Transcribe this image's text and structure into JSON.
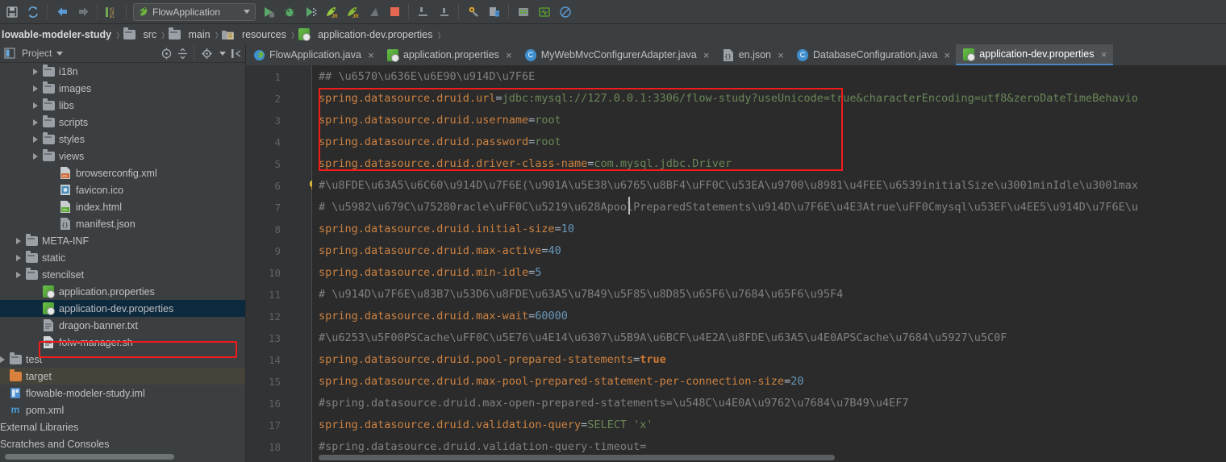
{
  "toolbar": {
    "buttons": [
      {
        "name": "save-all-icon",
        "glyph": "💾"
      },
      {
        "name": "sync-icon",
        "glyph": "⟳"
      },
      {
        "name": "back-icon",
        "glyph": "←"
      },
      {
        "name": "forward-icon",
        "glyph": "→"
      },
      {
        "name": "toggle-bookmarks-icon",
        "glyph": "01"
      },
      {
        "name": "run-icon",
        "glyph": "▶"
      },
      {
        "name": "debug-icon",
        "glyph": "🐞"
      },
      {
        "name": "run-coverage-icon",
        "glyph": "▶"
      },
      {
        "name": "run-jrebel-icon",
        "glyph": "JR"
      },
      {
        "name": "debug-jrebel-icon",
        "glyph": "JR"
      },
      {
        "name": "profile-icon",
        "glyph": "▲"
      },
      {
        "name": "stop-icon",
        "glyph": "■"
      },
      {
        "name": "build-project-icon",
        "glyph": "🔨"
      },
      {
        "name": "build-module-icon",
        "glyph": "🔨"
      },
      {
        "name": "settings-icon",
        "glyph": "🔧"
      },
      {
        "name": "project-structure-icon",
        "glyph": "☷"
      },
      {
        "name": "sdk-manager-icon",
        "glyph": "▦"
      },
      {
        "name": "avd-manager-icon",
        "glyph": "□"
      },
      {
        "name": "no-entry-icon",
        "glyph": "⊘"
      }
    ],
    "run_configuration": "FlowApplication"
  },
  "breadcrumb": {
    "items": [
      {
        "label": "lowable-modeler-study",
        "icon": ""
      },
      {
        "label": "src",
        "icon": "folder-icon"
      },
      {
        "label": "main",
        "icon": "folder-icon"
      },
      {
        "label": "resources",
        "icon": "resources-folder-icon"
      },
      {
        "label": "application-dev.properties",
        "icon": "properties-file-icon"
      }
    ]
  },
  "project_panel": {
    "title": "Project",
    "header_icons": [
      "locate-icon",
      "collapse-all-icon",
      "settings-icon",
      "hide-icon"
    ],
    "tree": [
      {
        "label": "i18n",
        "indent": 3,
        "arrow": true,
        "icon": "folder-icon",
        "state": "normal"
      },
      {
        "label": "images",
        "indent": 3,
        "arrow": true,
        "icon": "folder-icon",
        "state": "normal"
      },
      {
        "label": "libs",
        "indent": 3,
        "arrow": true,
        "icon": "folder-icon",
        "state": "normal"
      },
      {
        "label": "scripts",
        "indent": 3,
        "arrow": true,
        "icon": "folder-icon",
        "state": "normal"
      },
      {
        "label": "styles",
        "indent": 3,
        "arrow": true,
        "icon": "folder-icon",
        "state": "normal"
      },
      {
        "label": "views",
        "indent": 3,
        "arrow": true,
        "icon": "folder-icon",
        "state": "normal"
      },
      {
        "label": "browserconfig.xml",
        "indent": 4,
        "arrow": false,
        "icon": "xml-file-icon",
        "state": "normal"
      },
      {
        "label": "favicon.ico",
        "indent": 4,
        "arrow": false,
        "icon": "ico-file-icon",
        "state": "normal"
      },
      {
        "label": "index.html",
        "indent": 4,
        "arrow": false,
        "icon": "html-file-icon",
        "state": "normal"
      },
      {
        "label": "manifest.json",
        "indent": 4,
        "arrow": false,
        "icon": "json-file-icon",
        "state": "normal"
      },
      {
        "label": "META-INF",
        "indent": 2,
        "arrow": true,
        "icon": "folder-icon",
        "state": "normal"
      },
      {
        "label": "static",
        "indent": 2,
        "arrow": true,
        "icon": "folder-icon",
        "state": "normal"
      },
      {
        "label": "stencilset",
        "indent": 2,
        "arrow": true,
        "icon": "folder-icon",
        "state": "normal"
      },
      {
        "label": "application.properties",
        "indent": 3,
        "arrow": false,
        "icon": "properties-file-icon",
        "state": "normal"
      },
      {
        "label": "application-dev.properties",
        "indent": 3,
        "arrow": false,
        "icon": "properties-file-icon",
        "state": "selected"
      },
      {
        "label": "dragon-banner.txt",
        "indent": 3,
        "arrow": false,
        "icon": "txt-file-icon",
        "state": "normal"
      },
      {
        "label": "folw-manager.sh",
        "indent": 3,
        "arrow": false,
        "icon": "sh-file-icon",
        "state": "normal"
      },
      {
        "label": "test",
        "indent": 0,
        "arrow": true,
        "icon": "folder-icon",
        "state": "normal"
      },
      {
        "label": "target",
        "indent": 0,
        "arrow": false,
        "icon": "target-folder-icon",
        "state": "highlight"
      },
      {
        "label": "flowable-modeler-study.iml",
        "indent": 0,
        "arrow": false,
        "icon": "iml-file-icon",
        "state": "normal"
      },
      {
        "label": "pom.xml",
        "indent": 0,
        "arrow": false,
        "icon": "maven-file-icon",
        "state": "normal"
      },
      {
        "label": "External Libraries",
        "indent": -1,
        "arrow": false,
        "icon": "",
        "state": "normal"
      },
      {
        "label": "Scratches and Consoles",
        "indent": -1,
        "arrow": false,
        "icon": "",
        "state": "normal"
      }
    ]
  },
  "editor_tabs": [
    {
      "label": "FlowApplication.java",
      "icon": "spring-class-icon",
      "active": false
    },
    {
      "label": "application.properties",
      "icon": "properties-file-icon",
      "active": false
    },
    {
      "label": "MyWebMvcConfigurerAdapter.java",
      "icon": "java-class-icon",
      "active": false
    },
    {
      "label": "en.json",
      "icon": "json-file-icon",
      "active": false
    },
    {
      "label": "DatabaseConfiguration.java",
      "icon": "java-class-icon",
      "active": false
    },
    {
      "label": "application-dev.properties",
      "icon": "properties-file-icon",
      "active": true
    }
  ],
  "editor": {
    "file": "application-dev.properties",
    "lines": [
      {
        "num": 1,
        "type": "comment",
        "text": "## \\u6570\\u636E\\u6E90\\u914D\\u7F6E"
      },
      {
        "num": 2,
        "type": "prop",
        "key": "spring.datasource.druid.url",
        "value": "jdbc:mysql://127.0.0.1:3306/flow-study?useUnicode=true&characterEncoding=utf8&zeroDateTimeBehavio",
        "value_kind": "url"
      },
      {
        "num": 3,
        "type": "prop",
        "key": "spring.datasource.druid.username",
        "value": "root",
        "value_kind": "url"
      },
      {
        "num": 4,
        "type": "prop",
        "key": "spring.datasource.druid.password",
        "value": "root",
        "value_kind": "url"
      },
      {
        "num": 5,
        "type": "prop",
        "key": "spring.datasource.druid.driver-class-name",
        "value": "com.mysql.jdbc.Driver",
        "value_kind": "url"
      },
      {
        "num": 6,
        "type": "comment",
        "text": "#\\u8FDE\\u63A5\\u6C60\\u914D\\u7F6E(\\u901A\\u5E38\\u6765\\u8BF4\\uFF0C\\u53EA\\u9700\\u8981\\u4FEE\\u6539initialSize\\u3001minIdle\\u3001max",
        "bulb": true
      },
      {
        "num": 7,
        "type": "comment",
        "text": "# \\u5982\\u679C\\u75280racle\\uFF0C\\u5219\\u628ApoolPreparedStatements\\u914D\\u7F6E\\u4E3Atrue\\uFF0Cmysql\\u53EF\\u4EE5\\u914D\\u7F6E\\u"
      },
      {
        "num": 8,
        "type": "prop",
        "key": "spring.datasource.druid.initial-size",
        "value": "10",
        "value_kind": "num"
      },
      {
        "num": 9,
        "type": "prop",
        "key": "spring.datasource.druid.max-active",
        "value": "40",
        "value_kind": "num"
      },
      {
        "num": 10,
        "type": "prop",
        "key": "spring.datasource.druid.min-idle",
        "value": "5",
        "value_kind": "num"
      },
      {
        "num": 11,
        "type": "comment",
        "text": "# \\u914D\\u7F6E\\u83B7\\u53D6\\u8FDE\\u63A5\\u7B49\\u5F85\\u8D85\\u65F6\\u7684\\u65F6\\u95F4"
      },
      {
        "num": 12,
        "type": "prop",
        "key": "spring.datasource.druid.max-wait",
        "value": "60000",
        "value_kind": "num"
      },
      {
        "num": 13,
        "type": "comment",
        "text": "#\\u6253\\u5F00PSCache\\uFF0C\\u5E76\\u4E14\\u6307\\u5B9A\\u6BCF\\u4E2A\\u8FDE\\u63A5\\u4E0APSCache\\u7684\\u5927\\u5C0F"
      },
      {
        "num": 14,
        "type": "prop",
        "key": "spring.datasource.druid.pool-prepared-statements",
        "value": "true",
        "value_kind": "bool"
      },
      {
        "num": 15,
        "type": "prop",
        "key": "spring.datasource.druid.max-pool-prepared-statement-per-connection-size",
        "value": "20",
        "value_kind": "num"
      },
      {
        "num": 16,
        "type": "comment",
        "text": "#spring.datasource.druid.max-open-prepared-statements=\\u548C\\u4E0A\\u9762\\u7684\\u7B49\\u4EF7"
      },
      {
        "num": 17,
        "type": "prop",
        "key": "spring.datasource.druid.validation-query",
        "value": "SELECT 'x'",
        "value_kind": "str"
      },
      {
        "num": 18,
        "type": "comment",
        "text": "#spring.datasource.druid.validation-query-timeout="
      }
    ]
  },
  "colors": {
    "editor_bg": "#2b2b2b",
    "panel_bg": "#3c3f41",
    "gutter_bg": "#313335",
    "annotation_red": "#f21b1b",
    "selection_blue": "#0d293e",
    "active_tab_underline": "#4a88c7",
    "key_orange": "#cc8242",
    "number_blue": "#6897bb",
    "string_green": "#6a8759",
    "comment_gray": "#808080"
  }
}
